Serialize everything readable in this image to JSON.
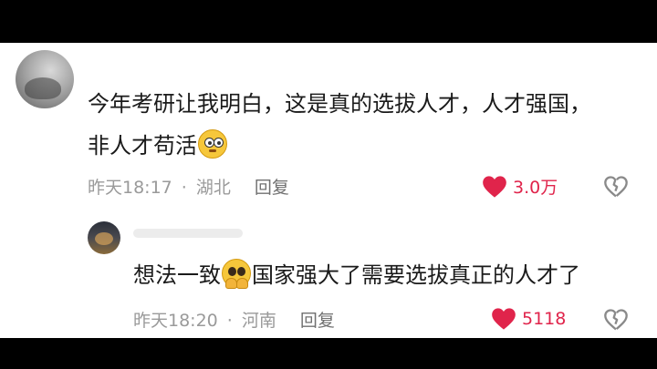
{
  "colors": {
    "like": "#e0244b",
    "meta": "#9a9a9a",
    "text": "#1a1a1a"
  },
  "comment": {
    "text_line1": "今年考研让我明白，这是真的选拔人才，人才强国，",
    "text_line2": "非人才苟活",
    "emoji": "flushed-face",
    "time": "昨天18:17",
    "separator": "·",
    "location": "湖北",
    "reply_label": "回复",
    "likes": "3.0万"
  },
  "reply": {
    "text_before_emoji": "想法一致",
    "emoji": "pleading-face",
    "text_after_emoji": "国家强大了需要选拔真正的人才了",
    "time": "昨天18:20",
    "separator": "·",
    "location": "河南",
    "reply_label": "回复",
    "likes": "5118"
  }
}
